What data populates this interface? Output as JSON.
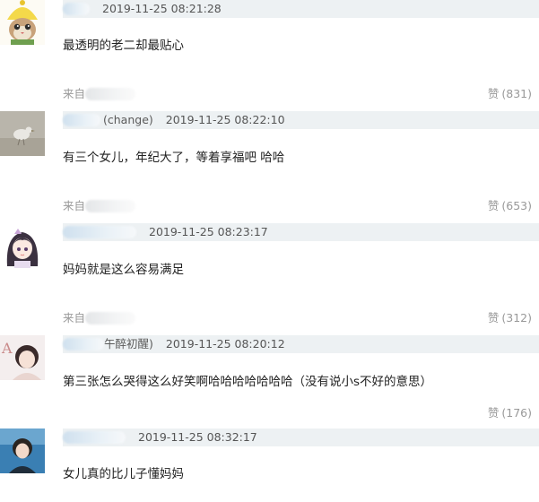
{
  "comments": [
    {
      "username_visible": "",
      "timestamp": "2019-11-25 08:21:28",
      "text": "最透明的老二却最贴心",
      "source_label": "来自",
      "like_label": "赞",
      "likes": "(831)",
      "avatar": "cat-in-lemon-hat-icon"
    },
    {
      "username_visible": "(change)",
      "timestamp": "2019-11-25 08:22:10",
      "text": "有三个女儿，年纪大了，等着享福吧 哈哈",
      "source_label": "来自",
      "like_label": "赞",
      "likes": "(653)",
      "avatar": "bird-photo-icon"
    },
    {
      "username_visible": "",
      "timestamp": "2019-11-25 08:23:17",
      "text": "妈妈就是这么容易满足",
      "source_label": "来自",
      "like_label": "赞",
      "likes": "(312)",
      "avatar": "anime-girl-icon"
    },
    {
      "username_visible": "午醉初醒)",
      "timestamp": "2019-11-25 08:20:12",
      "text": "第三张怎么哭得这么好笑啊哈哈哈哈哈哈哈（没有说小s不好的意思）",
      "source_label": "",
      "like_label": "赞",
      "likes": "(176)",
      "avatar": "woman-portrait-icon"
    },
    {
      "username_visible": "",
      "timestamp": "2019-11-25 08:32:17",
      "text": "女儿真的比儿子懂妈妈",
      "avatar": "blue-portrait-icon"
    }
  ]
}
